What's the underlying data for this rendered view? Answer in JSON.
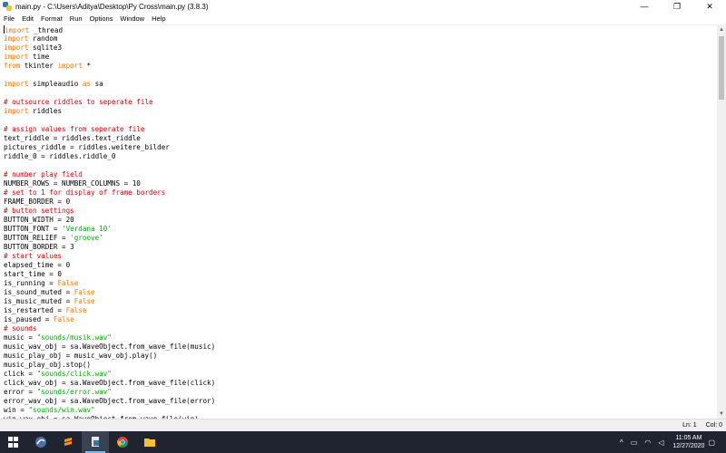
{
  "window": {
    "title": "main.py - C:\\Users\\Aditya\\Desktop\\Py Cross\\main.py (3.8.3)",
    "controls": {
      "minimize": "—",
      "maximize": "❐",
      "close": "✕"
    }
  },
  "menu": {
    "items": [
      "File",
      "Edit",
      "Format",
      "Run",
      "Options",
      "Window",
      "Help"
    ]
  },
  "code": {
    "lines": [
      [
        [
          "kw",
          "import"
        ],
        [
          "t",
          " _thread"
        ]
      ],
      [
        [
          "kw",
          "import"
        ],
        [
          "t",
          " random"
        ]
      ],
      [
        [
          "kw",
          "import"
        ],
        [
          "t",
          " sqlite3"
        ]
      ],
      [
        [
          "kw",
          "import"
        ],
        [
          "t",
          " time"
        ]
      ],
      [
        [
          "kw",
          "from"
        ],
        [
          "t",
          " tkinter "
        ],
        [
          "kw",
          "import"
        ],
        [
          "t",
          " *"
        ]
      ],
      [
        [
          "t",
          ""
        ]
      ],
      [
        [
          "kw",
          "import"
        ],
        [
          "t",
          " simpleaudio "
        ],
        [
          "kw",
          "as"
        ],
        [
          "t",
          " sa"
        ]
      ],
      [
        [
          "t",
          ""
        ]
      ],
      [
        [
          "cm",
          "# outsource riddles to seperate file"
        ]
      ],
      [
        [
          "kw",
          "import"
        ],
        [
          "t",
          " riddles"
        ]
      ],
      [
        [
          "t",
          ""
        ]
      ],
      [
        [
          "cm",
          "# assign values from seperate file"
        ]
      ],
      [
        [
          "t",
          "text_riddle = riddles.text_riddle"
        ]
      ],
      [
        [
          "t",
          "pictures_riddle = riddles.weitere_bilder"
        ]
      ],
      [
        [
          "t",
          "riddle_0 = riddles.riddle_0"
        ]
      ],
      [
        [
          "t",
          ""
        ]
      ],
      [
        [
          "cm",
          "# number play field"
        ]
      ],
      [
        [
          "t",
          "NUMBER_ROWS = NUMBER_COLUMNS = 10"
        ]
      ],
      [
        [
          "cm",
          "# set to 1 for display of frame borders"
        ]
      ],
      [
        [
          "t",
          "FRAME_BORDER = 0"
        ]
      ],
      [
        [
          "cm",
          "# button settings"
        ]
      ],
      [
        [
          "t",
          "BUTTON_WIDTH = 20"
        ]
      ],
      [
        [
          "t",
          "BUTTON_FONT = "
        ],
        [
          "st",
          "'Verdana 10'"
        ]
      ],
      [
        [
          "t",
          "BUTTON_RELIEF = "
        ],
        [
          "st",
          "'groove'"
        ]
      ],
      [
        [
          "t",
          "BUTTON_BORDER = 3"
        ]
      ],
      [
        [
          "cm",
          "# start values"
        ]
      ],
      [
        [
          "t",
          "elapsed_time = 0"
        ]
      ],
      [
        [
          "t",
          "start_time = 0"
        ]
      ],
      [
        [
          "t",
          "is_running = "
        ],
        [
          "kw",
          "False"
        ]
      ],
      [
        [
          "t",
          "is_sound_muted = "
        ],
        [
          "kw",
          "False"
        ]
      ],
      [
        [
          "t",
          "is_music_muted = "
        ],
        [
          "kw",
          "False"
        ]
      ],
      [
        [
          "t",
          "is_restarted = "
        ],
        [
          "kw",
          "False"
        ]
      ],
      [
        [
          "t",
          "is_paused = "
        ],
        [
          "kw",
          "False"
        ]
      ],
      [
        [
          "cm",
          "# sounds"
        ]
      ],
      [
        [
          "t",
          "music = "
        ],
        [
          "st",
          "\"sounds/musik.wav\""
        ]
      ],
      [
        [
          "t",
          "music_wav_obj = sa.WaveObject.from_wave_file(music)"
        ]
      ],
      [
        [
          "t",
          "music_play_obj = music_wav_obj.play()"
        ]
      ],
      [
        [
          "t",
          "music_play_obj.stop()"
        ]
      ],
      [
        [
          "t",
          "click = "
        ],
        [
          "st",
          "\"sounds/click.wav\""
        ]
      ],
      [
        [
          "t",
          "click_wav_obj = sa.WaveObject.from_wave_file(click)"
        ]
      ],
      [
        [
          "t",
          "error = "
        ],
        [
          "st",
          "\"sounds/error.wav\""
        ]
      ],
      [
        [
          "t",
          "error_wav_obj = sa.WaveObject.from_wave_file(error)"
        ]
      ],
      [
        [
          "t",
          "win = "
        ],
        [
          "st",
          "\"sounds/win.wav\""
        ]
      ],
      [
        [
          "t",
          "win_wav_obj = sa.WaveObject.from_wave_file(win)"
        ]
      ]
    ]
  },
  "status": {
    "line": "Ln: 1",
    "col": "Col: 0"
  },
  "taskbar": {
    "time": "11:05 AM",
    "date": "12/27/2020",
    "tray": {
      "chevron": "^",
      "battery": "▭",
      "wifi": "◠",
      "volume": "◁",
      "notifications": "▢"
    }
  },
  "colors": {
    "keyword": "#ff7700",
    "comment": "#dd0000",
    "string": "#00aa00",
    "taskbar": "#1f2430"
  }
}
